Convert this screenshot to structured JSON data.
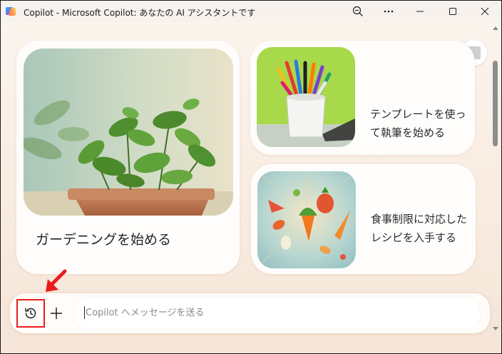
{
  "window": {
    "title": "Copilot - Microsoft Copilot: あなたの AI アシスタントです"
  },
  "titlebar_buttons": {
    "zoom_icon": "zoom-out-icon",
    "more_icon": "more-horizontal-icon",
    "minimize_icon": "minimize-icon",
    "maximize_icon": "maximize-icon",
    "close_icon": "close-icon"
  },
  "cards": [
    {
      "label": "ガーデニングを始める",
      "image": "basil-plant-pot"
    },
    {
      "label": "テンプレートを使って執筆を始める",
      "image": "pencil-cup"
    },
    {
      "label": "食事制限に対応したレシピを入手する",
      "image": "flying-vegetables"
    }
  ],
  "composer": {
    "placeholder": "Copilot へメッセージを送る",
    "value": "",
    "history_icon": "history-icon",
    "plus_icon": "plus-icon"
  },
  "annotations": {
    "highlight_color": "#e81d1d"
  }
}
